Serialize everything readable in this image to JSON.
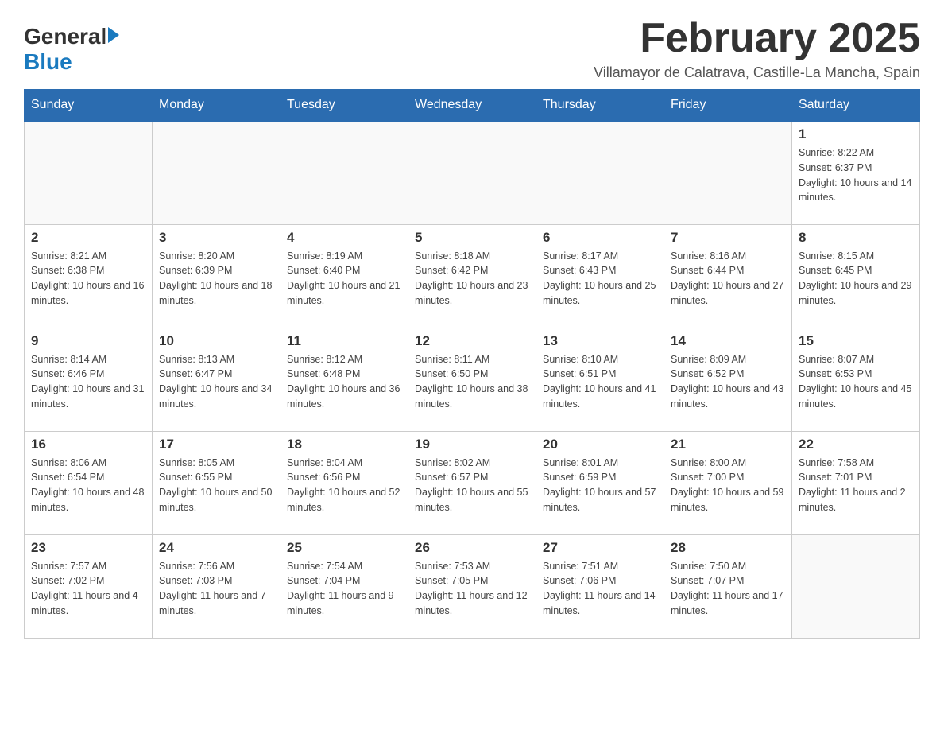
{
  "header": {
    "logo": {
      "general": "General",
      "arrow": "▶",
      "blue": "Blue"
    },
    "title": "February 2025",
    "subtitle": "Villamayor de Calatrava, Castille-La Mancha, Spain"
  },
  "weekdays": [
    "Sunday",
    "Monday",
    "Tuesday",
    "Wednesday",
    "Thursday",
    "Friday",
    "Saturday"
  ],
  "weeks": [
    [
      {
        "day": "",
        "info": ""
      },
      {
        "day": "",
        "info": ""
      },
      {
        "day": "",
        "info": ""
      },
      {
        "day": "",
        "info": ""
      },
      {
        "day": "",
        "info": ""
      },
      {
        "day": "",
        "info": ""
      },
      {
        "day": "1",
        "info": "Sunrise: 8:22 AM\nSunset: 6:37 PM\nDaylight: 10 hours and 14 minutes."
      }
    ],
    [
      {
        "day": "2",
        "info": "Sunrise: 8:21 AM\nSunset: 6:38 PM\nDaylight: 10 hours and 16 minutes."
      },
      {
        "day": "3",
        "info": "Sunrise: 8:20 AM\nSunset: 6:39 PM\nDaylight: 10 hours and 18 minutes."
      },
      {
        "day": "4",
        "info": "Sunrise: 8:19 AM\nSunset: 6:40 PM\nDaylight: 10 hours and 21 minutes."
      },
      {
        "day": "5",
        "info": "Sunrise: 8:18 AM\nSunset: 6:42 PM\nDaylight: 10 hours and 23 minutes."
      },
      {
        "day": "6",
        "info": "Sunrise: 8:17 AM\nSunset: 6:43 PM\nDaylight: 10 hours and 25 minutes."
      },
      {
        "day": "7",
        "info": "Sunrise: 8:16 AM\nSunset: 6:44 PM\nDaylight: 10 hours and 27 minutes."
      },
      {
        "day": "8",
        "info": "Sunrise: 8:15 AM\nSunset: 6:45 PM\nDaylight: 10 hours and 29 minutes."
      }
    ],
    [
      {
        "day": "9",
        "info": "Sunrise: 8:14 AM\nSunset: 6:46 PM\nDaylight: 10 hours and 31 minutes."
      },
      {
        "day": "10",
        "info": "Sunrise: 8:13 AM\nSunset: 6:47 PM\nDaylight: 10 hours and 34 minutes."
      },
      {
        "day": "11",
        "info": "Sunrise: 8:12 AM\nSunset: 6:48 PM\nDaylight: 10 hours and 36 minutes."
      },
      {
        "day": "12",
        "info": "Sunrise: 8:11 AM\nSunset: 6:50 PM\nDaylight: 10 hours and 38 minutes."
      },
      {
        "day": "13",
        "info": "Sunrise: 8:10 AM\nSunset: 6:51 PM\nDaylight: 10 hours and 41 minutes."
      },
      {
        "day": "14",
        "info": "Sunrise: 8:09 AM\nSunset: 6:52 PM\nDaylight: 10 hours and 43 minutes."
      },
      {
        "day": "15",
        "info": "Sunrise: 8:07 AM\nSunset: 6:53 PM\nDaylight: 10 hours and 45 minutes."
      }
    ],
    [
      {
        "day": "16",
        "info": "Sunrise: 8:06 AM\nSunset: 6:54 PM\nDaylight: 10 hours and 48 minutes."
      },
      {
        "day": "17",
        "info": "Sunrise: 8:05 AM\nSunset: 6:55 PM\nDaylight: 10 hours and 50 minutes."
      },
      {
        "day": "18",
        "info": "Sunrise: 8:04 AM\nSunset: 6:56 PM\nDaylight: 10 hours and 52 minutes."
      },
      {
        "day": "19",
        "info": "Sunrise: 8:02 AM\nSunset: 6:57 PM\nDaylight: 10 hours and 55 minutes."
      },
      {
        "day": "20",
        "info": "Sunrise: 8:01 AM\nSunset: 6:59 PM\nDaylight: 10 hours and 57 minutes."
      },
      {
        "day": "21",
        "info": "Sunrise: 8:00 AM\nSunset: 7:00 PM\nDaylight: 10 hours and 59 minutes."
      },
      {
        "day": "22",
        "info": "Sunrise: 7:58 AM\nSunset: 7:01 PM\nDaylight: 11 hours and 2 minutes."
      }
    ],
    [
      {
        "day": "23",
        "info": "Sunrise: 7:57 AM\nSunset: 7:02 PM\nDaylight: 11 hours and 4 minutes."
      },
      {
        "day": "24",
        "info": "Sunrise: 7:56 AM\nSunset: 7:03 PM\nDaylight: 11 hours and 7 minutes."
      },
      {
        "day": "25",
        "info": "Sunrise: 7:54 AM\nSunset: 7:04 PM\nDaylight: 11 hours and 9 minutes."
      },
      {
        "day": "26",
        "info": "Sunrise: 7:53 AM\nSunset: 7:05 PM\nDaylight: 11 hours and 12 minutes."
      },
      {
        "day": "27",
        "info": "Sunrise: 7:51 AM\nSunset: 7:06 PM\nDaylight: 11 hours and 14 minutes."
      },
      {
        "day": "28",
        "info": "Sunrise: 7:50 AM\nSunset: 7:07 PM\nDaylight: 11 hours and 17 minutes."
      },
      {
        "day": "",
        "info": ""
      }
    ]
  ],
  "accent_color": "#2b6cb0"
}
